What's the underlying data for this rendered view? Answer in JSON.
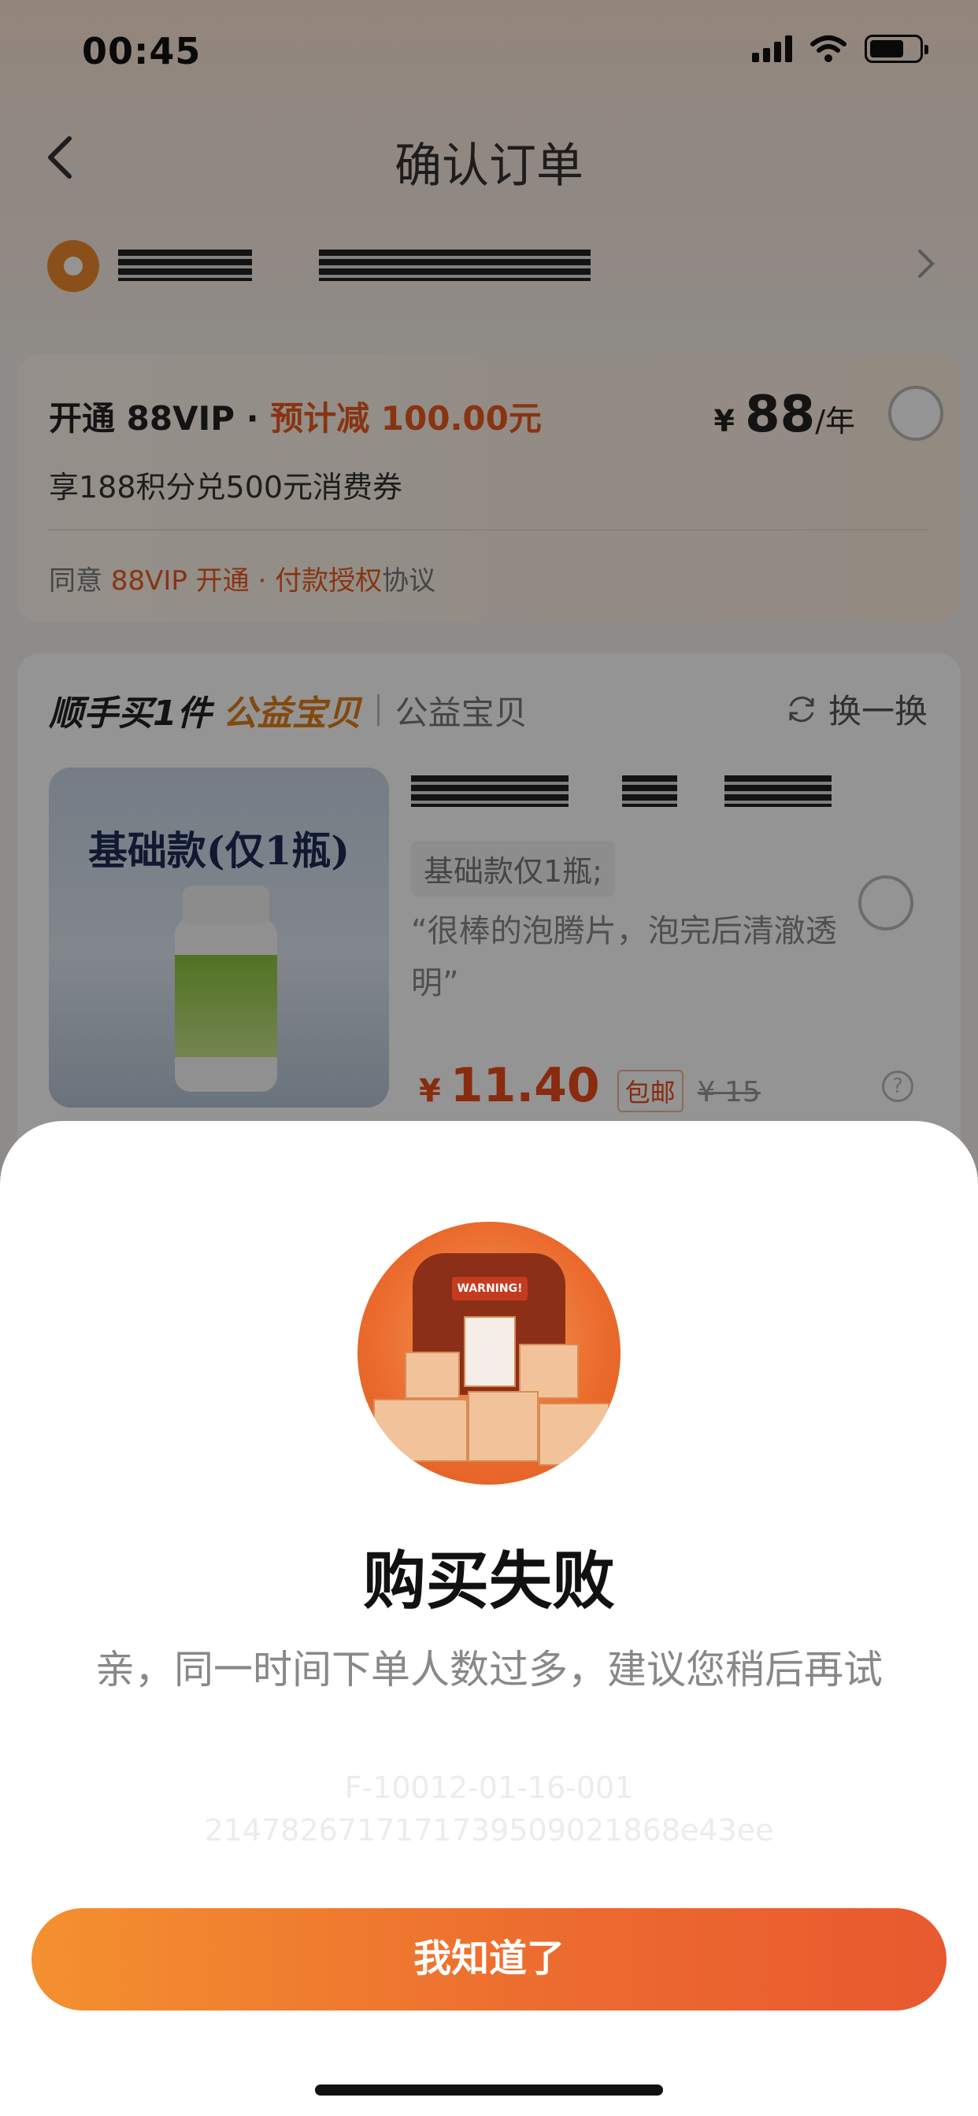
{
  "status_bar": {
    "time": "00:45"
  },
  "nav": {
    "title": "确认订单"
  },
  "vip": {
    "open_label": "开通 88VIP · ",
    "discount_label": "预计减 100.00元",
    "price_currency": "¥",
    "price_value": "88",
    "price_unit": "/年",
    "benefit": "享188积分兑500元消费券",
    "agree_prefix": "同意 ",
    "agree_link": "88VIP 开通 · 付款授权",
    "agree_suffix": "协议"
  },
  "charity": {
    "title": "顺手买1件",
    "accent": "公益宝贝",
    "subtitle": "公益宝贝",
    "swap_label": "换一换",
    "image_title": "基础款(仅1瓶)",
    "sku": "基础款仅1瓶;",
    "review": "“很棒的泡腾片，泡完后清澈透明”",
    "price_currency": "¥",
    "price_value": "11.40",
    "free_shipping": "包邮",
    "original_price": "¥ 15"
  },
  "dialog": {
    "title": "购买失败",
    "message": "亲，同一时间下单人数过多，建议您稍后再试",
    "error_code_1": "F-10012-01-16-001",
    "error_code_2": "2147826717171739509021868e43ee",
    "button_label": "我知道了",
    "warning_text": "WARNING!"
  },
  "colors": {
    "accent": "#ea5a1f",
    "button_start": "#f4902f",
    "button_end": "#e8592f"
  }
}
